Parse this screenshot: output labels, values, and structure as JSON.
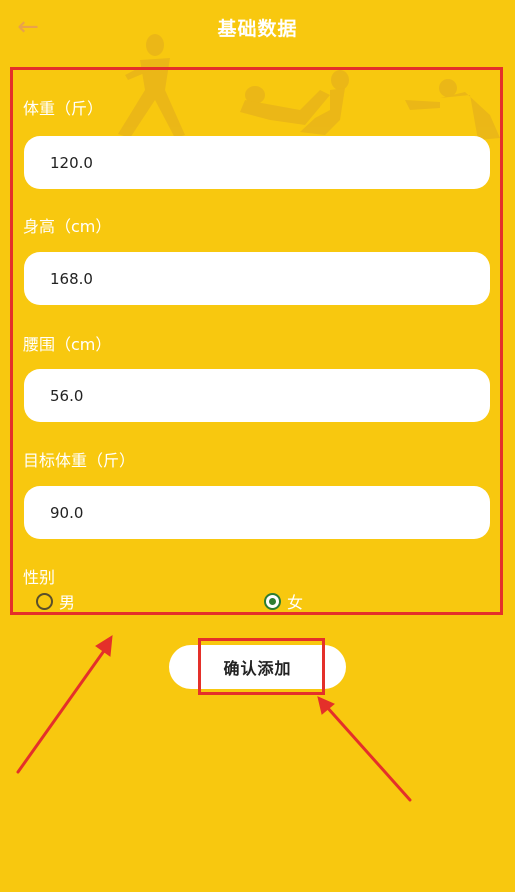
{
  "header": {
    "back_icon": "back-arrow-icon",
    "title": "基础数据"
  },
  "form": {
    "weight": {
      "label": "体重（斤）",
      "value": "120.0"
    },
    "height": {
      "label": "身高（cm）",
      "value": "168.0"
    },
    "waist": {
      "label": "腰围（cm）",
      "value": "56.0"
    },
    "target_weight": {
      "label": "目标体重（斤）",
      "value": "90.0"
    },
    "gender": {
      "label": "性别",
      "options": [
        {
          "label": "男",
          "selected": false
        },
        {
          "label": "女",
          "selected": true
        }
      ]
    }
  },
  "confirm_label": "确认添加",
  "colors": {
    "background": "#f8c80f",
    "highlight": "#e4302a",
    "radio_selected": "#2e7d32"
  }
}
